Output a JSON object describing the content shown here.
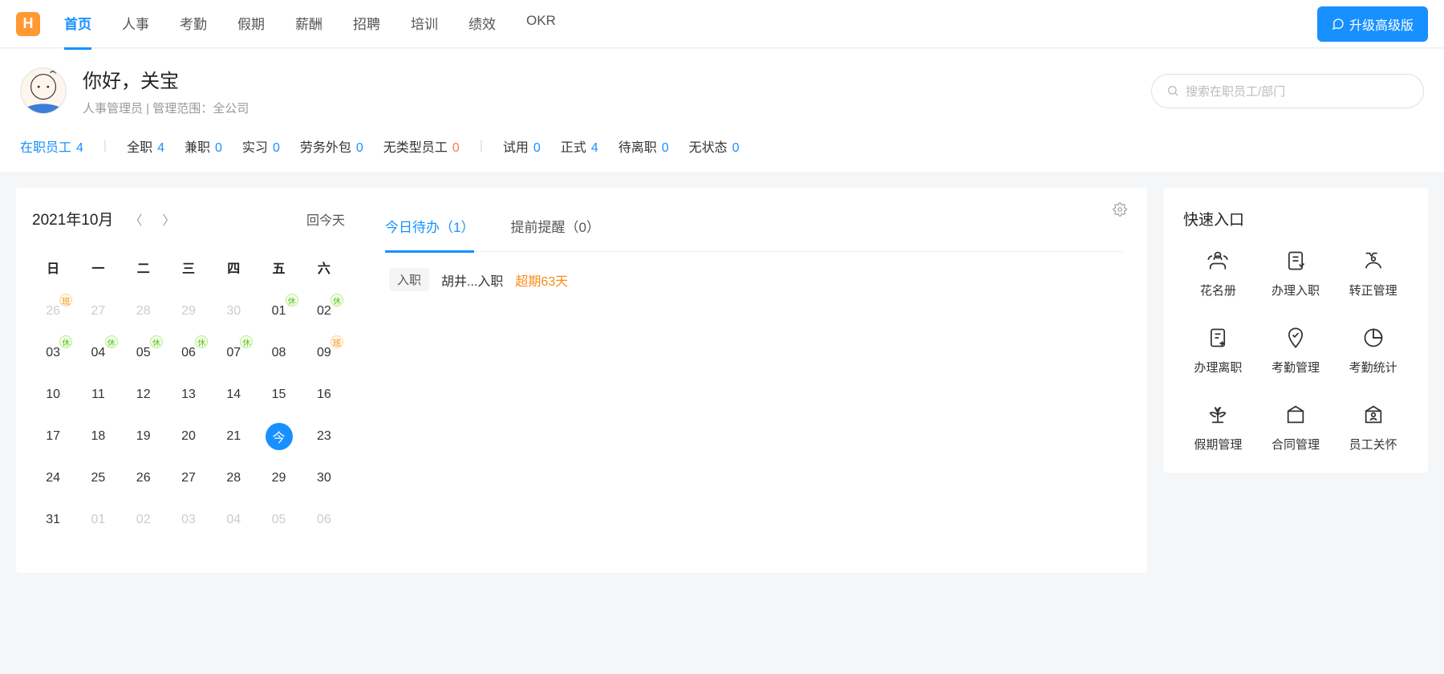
{
  "nav": {
    "items": [
      "首页",
      "人事",
      "考勤",
      "假期",
      "薪酬",
      "招聘",
      "培训",
      "绩效",
      "OKR"
    ],
    "active": 0,
    "upgrade": "升级高级版"
  },
  "header": {
    "greeting": "你好，关宝",
    "role": "人事管理员",
    "scope_label": "管理范围：",
    "scope_value": "全公司",
    "search_placeholder": "搜索在职员工/部门"
  },
  "stats": [
    {
      "label": "在职员工",
      "value": "4",
      "link": true,
      "color": "blue"
    },
    {
      "divider": true
    },
    {
      "label": "全职",
      "value": "4",
      "color": "blue"
    },
    {
      "label": "兼职",
      "value": "0",
      "color": "blue"
    },
    {
      "label": "实习",
      "value": "0",
      "color": "blue"
    },
    {
      "label": "劳务外包",
      "value": "0",
      "color": "blue"
    },
    {
      "label": "无类型员工",
      "value": "0",
      "color": "orange"
    },
    {
      "divider": true
    },
    {
      "label": "试用",
      "value": "0",
      "color": "blue"
    },
    {
      "label": "正式",
      "value": "4",
      "color": "blue"
    },
    {
      "label": "待离职",
      "value": "0",
      "color": "blue"
    },
    {
      "label": "无状态",
      "value": "0",
      "color": "blue"
    }
  ],
  "calendar": {
    "title": "2021年10月",
    "today_link": "回今天",
    "dow": [
      "日",
      "一",
      "二",
      "三",
      "四",
      "五",
      "六"
    ],
    "days": [
      {
        "n": "26",
        "muted": true,
        "badge": "work"
      },
      {
        "n": "27",
        "muted": true
      },
      {
        "n": "28",
        "muted": true
      },
      {
        "n": "29",
        "muted": true
      },
      {
        "n": "30",
        "muted": true
      },
      {
        "n": "01",
        "badge": "rest"
      },
      {
        "n": "02",
        "badge": "rest"
      },
      {
        "n": "03",
        "badge": "rest"
      },
      {
        "n": "04",
        "badge": "rest"
      },
      {
        "n": "05",
        "badge": "rest"
      },
      {
        "n": "06",
        "badge": "rest"
      },
      {
        "n": "07",
        "badge": "rest"
      },
      {
        "n": "08"
      },
      {
        "n": "09",
        "badge": "work"
      },
      {
        "n": "10"
      },
      {
        "n": "11"
      },
      {
        "n": "12"
      },
      {
        "n": "13"
      },
      {
        "n": "14"
      },
      {
        "n": "15"
      },
      {
        "n": "16"
      },
      {
        "n": "17"
      },
      {
        "n": "18"
      },
      {
        "n": "19"
      },
      {
        "n": "20"
      },
      {
        "n": "21"
      },
      {
        "n": "今",
        "today": true
      },
      {
        "n": "23"
      },
      {
        "n": "24"
      },
      {
        "n": "25"
      },
      {
        "n": "26"
      },
      {
        "n": "27"
      },
      {
        "n": "28"
      },
      {
        "n": "29"
      },
      {
        "n": "30"
      },
      {
        "n": "31"
      },
      {
        "n": "01",
        "muted": true
      },
      {
        "n": "02",
        "muted": true
      },
      {
        "n": "03",
        "muted": true
      },
      {
        "n": "04",
        "muted": true
      },
      {
        "n": "05",
        "muted": true
      },
      {
        "n": "06",
        "muted": true
      }
    ],
    "badge_text": {
      "rest": "休",
      "work": "班"
    }
  },
  "todo": {
    "tabs": [
      {
        "label": "今日待办",
        "count": "1",
        "active": true
      },
      {
        "label": "提前提醒",
        "count": "0"
      }
    ],
    "items": [
      {
        "tag": "入职",
        "name": "胡井...入职",
        "overdue": "超期63天"
      }
    ]
  },
  "quick": {
    "title": "快速入口",
    "items": [
      {
        "icon": "roster",
        "label": "花名册"
      },
      {
        "icon": "onboard",
        "label": "办理入职"
      },
      {
        "icon": "regular",
        "label": "转正管理"
      },
      {
        "icon": "offboard",
        "label": "办理离职"
      },
      {
        "icon": "attendance",
        "label": "考勤管理"
      },
      {
        "icon": "attstat",
        "label": "考勤统计"
      },
      {
        "icon": "vacation",
        "label": "假期管理"
      },
      {
        "icon": "contract",
        "label": "合同管理"
      },
      {
        "icon": "care",
        "label": "员工关怀"
      }
    ]
  }
}
